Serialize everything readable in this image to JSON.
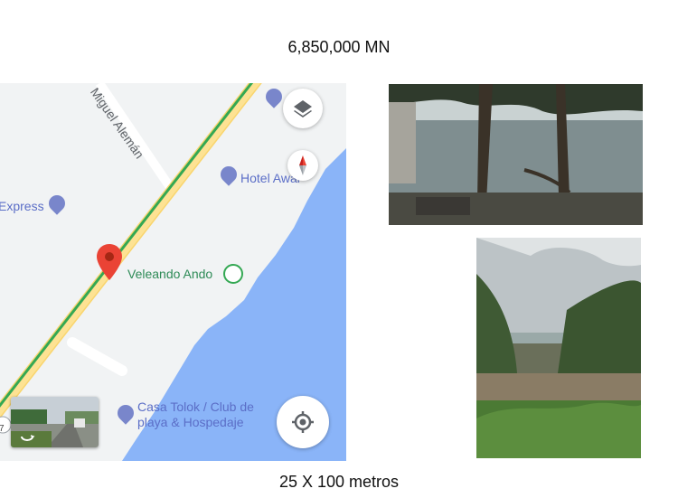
{
  "listing": {
    "price": "6,850,000 MN",
    "lot_size": "25 X 100 metros"
  },
  "map": {
    "road_label": "Miguel Alemán",
    "places": {
      "hotel_awal": "Hotel Awal",
      "express": "Express",
      "veleando_ando": "Veleando Ando",
      "casa_tolok_line1": "Casa Tolok / Club de",
      "casa_tolok_line2": "playa & Hospedaje"
    },
    "route_badge": "7",
    "colors": {
      "water": "#8ab4f8",
      "land": "#f1f3f4",
      "highway_fill": "#fde293",
      "traffic_green": "#34a853",
      "marker_red": "#ea4335",
      "poi_blue": "#7986cb",
      "poi_green": "#34a853"
    },
    "icons": [
      "layers-icon",
      "compass-icon",
      "my-location-icon",
      "street-view-icon",
      "location-pin-icon",
      "hotel-icon",
      "boat-icon"
    ]
  },
  "photos": {
    "waterfront": "waterfront trees and dock photo",
    "lot": "vegetated lot photo"
  }
}
